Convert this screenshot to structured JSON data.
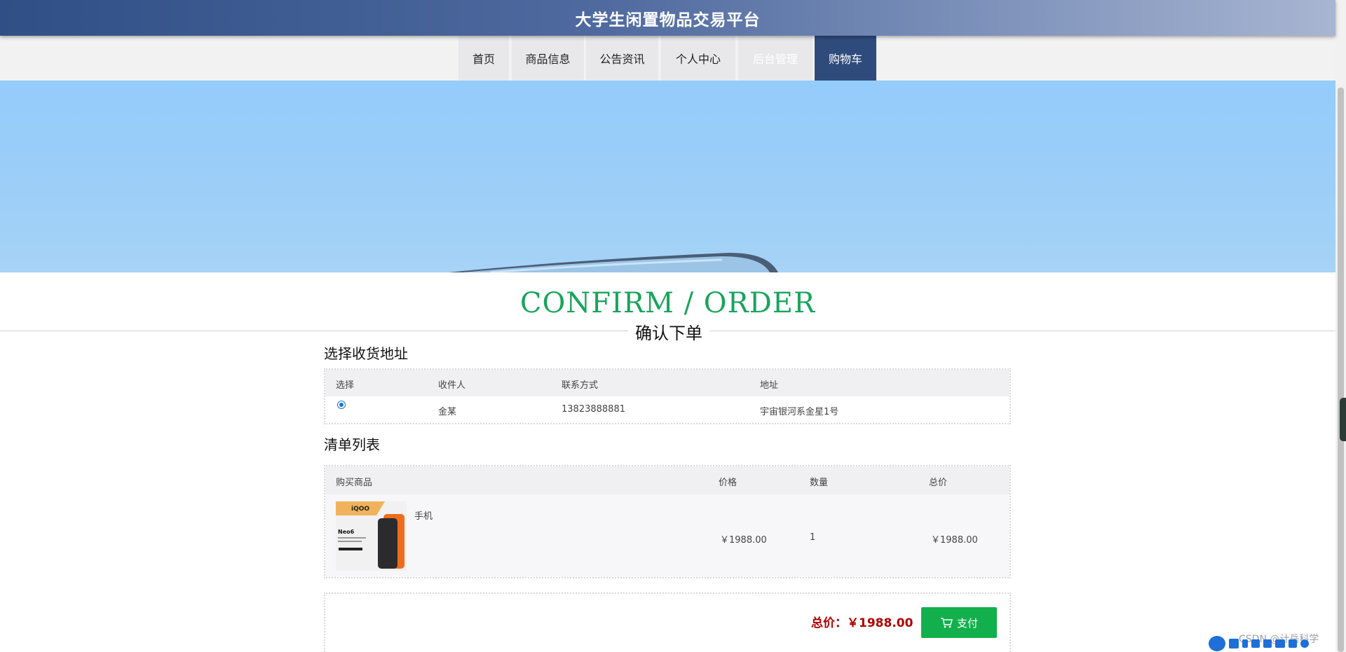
{
  "header": {
    "title": "大学生闲置物品交易平台"
  },
  "nav": {
    "items": [
      {
        "label": "首页"
      },
      {
        "label": "商品信息"
      },
      {
        "label": "公告资讯"
      },
      {
        "label": "个人中心"
      },
      {
        "label": "后台管理"
      },
      {
        "label": "购物车"
      }
    ],
    "active_index": 5
  },
  "section": {
    "heading": "CONFIRM / ORDER",
    "subheading": "确认下单"
  },
  "address": {
    "title": "选择收货地址",
    "columns": [
      "选择",
      "收件人",
      "联系方式",
      "地址"
    ],
    "rows": [
      {
        "selected": true,
        "recipient": "金某",
        "phone": "13823888881",
        "address": "宇宙银河系金星1号"
      }
    ]
  },
  "order_list": {
    "title": "清单列表",
    "columns": [
      "购买商品",
      "价格",
      "数量",
      "总价"
    ],
    "items": [
      {
        "name": "手机",
        "price": "￥1988.00",
        "quantity": "1",
        "total": "￥1988.00",
        "image": {
          "brand_text": "iQOO",
          "model_text": "Neo6"
        }
      }
    ]
  },
  "summary": {
    "total_label": "总价：￥1988.00",
    "pay_label": "支付"
  },
  "overlay": {
    "watermark": "CSDN @计岳科学"
  },
  "colors": {
    "header_start": "#2f4f86",
    "active_nav": "#2f4b7c",
    "heading_green": "#1aa35c",
    "pay_green": "#12b04c",
    "total_red": "#b00000"
  },
  "icons": {
    "pay": "cart-icon"
  }
}
